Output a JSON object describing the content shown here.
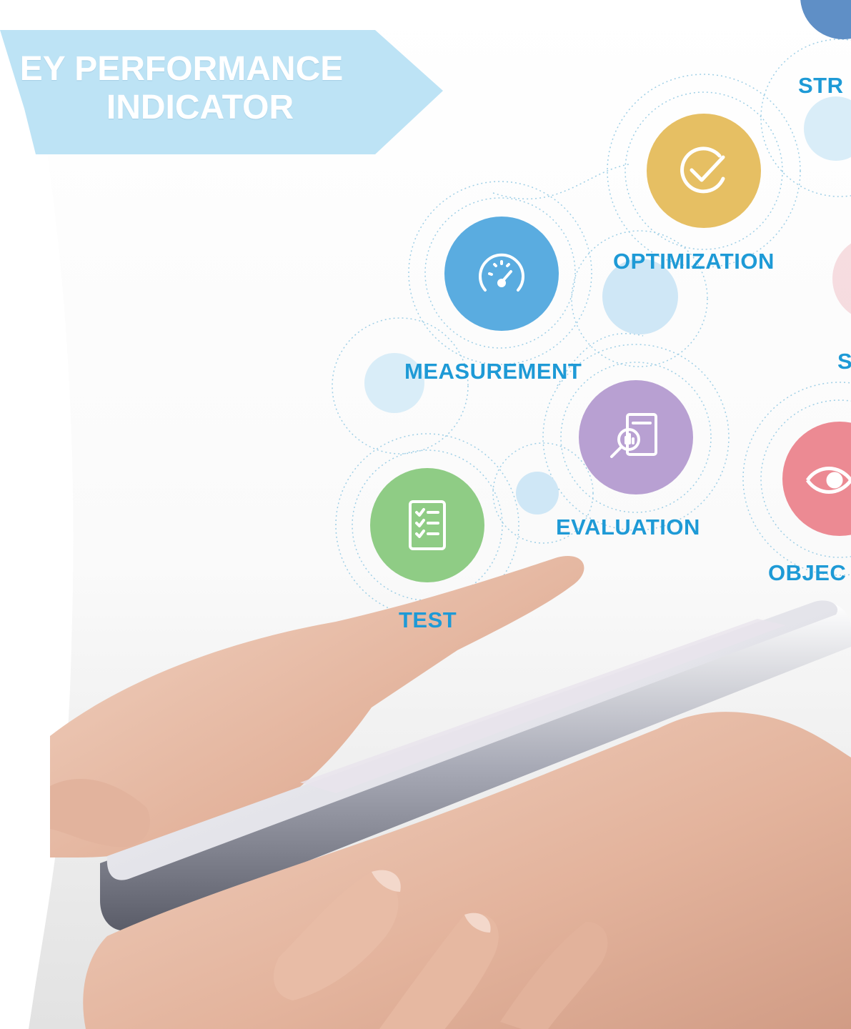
{
  "banner": {
    "line1": "EY PERFORMANCE",
    "line2": "INDICATOR",
    "color": "#bde3f5"
  },
  "nodes": [
    {
      "label": "OPTIMIZATION",
      "icon": "check-circle-icon",
      "color": "#e6bf63"
    },
    {
      "label": "MEASUREMENT",
      "icon": "speedometer-icon",
      "color": "#5aace0"
    },
    {
      "label": "EVALUATION",
      "icon": "report-magnifier-icon",
      "color": "#b8a0d2"
    },
    {
      "label": "TEST",
      "icon": "checklist-icon",
      "color": "#8fcc85"
    },
    {
      "label": "OBJEC",
      "icon": "eye-icon",
      "color": "#ec8a93"
    },
    {
      "label": "STR",
      "icon": "",
      "color": "#5f8fc6"
    },
    {
      "label": "S",
      "icon": "",
      "color": "#1e9ad6"
    }
  ],
  "label_color": "#1e9ad6"
}
